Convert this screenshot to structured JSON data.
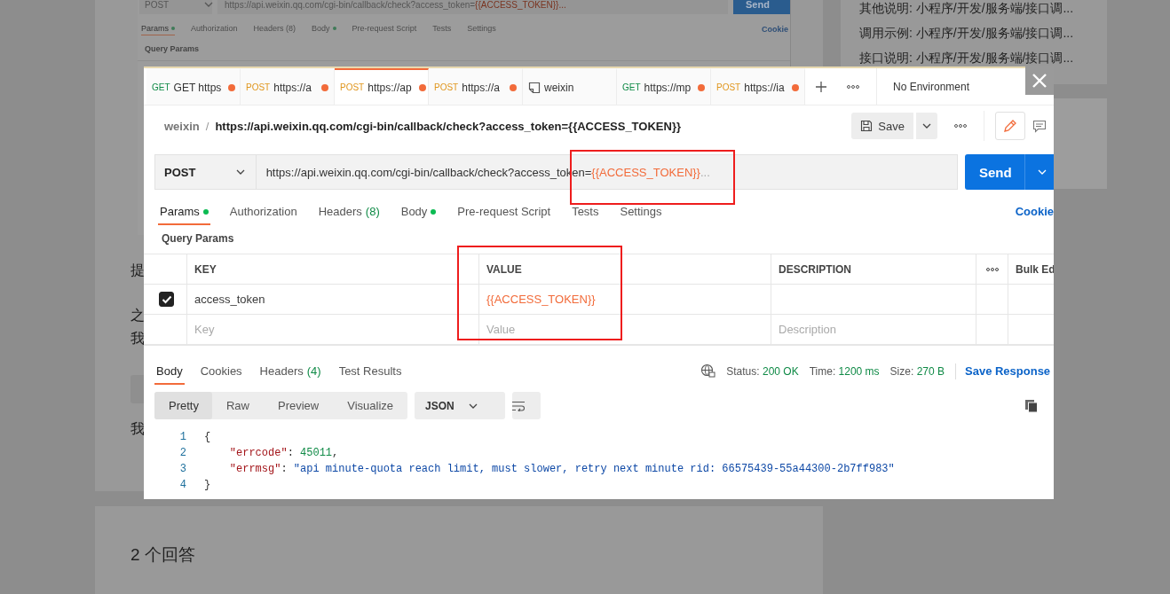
{
  "page": {
    "embedded_screenshot": {
      "method": "POST",
      "url": "https://api.weixin.qq.com/cgi-bin/callback/check?access_token=",
      "url_variable": "{{ACCESS_TOKEN}}",
      "url_more": " ...",
      "send": "Send",
      "tabs": [
        {
          "label": "Params",
          "dot": true,
          "selected": true
        },
        {
          "label": "Authorization",
          "dot": false,
          "selected": false
        },
        {
          "label": "Headers (8)",
          "dot": false,
          "selected": false
        },
        {
          "label": "Body",
          "dot": true,
          "selected": false
        },
        {
          "label": "Pre-request Script",
          "dot": false,
          "selected": false
        },
        {
          "label": "Tests",
          "dot": false,
          "selected": false
        },
        {
          "label": "Settings",
          "dot": false,
          "selected": false
        }
      ],
      "cookies": "Cookie",
      "section": "Query Params"
    },
    "question_text": [
      "提",
      "之",
      "我",
      "我"
    ],
    "answers_heading": "2 个回答",
    "sidebar_links": [
      "其他说明: 小程序/开发/服务端/接口调...",
      "调用示例: 小程序/开发/服务端/接口调...",
      "接口说明: 小程序/开发/服务端/接口调..."
    ]
  },
  "lightbox": {
    "tabs": [
      {
        "kind": "request",
        "method": "GET",
        "label": "GET https",
        "unsaved": true,
        "selected": false
      },
      {
        "kind": "request",
        "method": "POST",
        "label": "https://a",
        "unsaved": true,
        "selected": false
      },
      {
        "kind": "request",
        "method": "POST",
        "label": "https://ap",
        "unsaved": true,
        "selected": true
      },
      {
        "kind": "request",
        "method": "POST",
        "label": "https://a",
        "unsaved": true,
        "selected": false
      },
      {
        "kind": "collection",
        "label": "weixin",
        "unsaved": false,
        "selected": false
      },
      {
        "kind": "request",
        "method": "GET",
        "label": "https://mp",
        "unsaved": true,
        "selected": false
      },
      {
        "kind": "request",
        "method": "POST",
        "label": "https://ia",
        "unsaved": true,
        "selected": false
      }
    ],
    "environment": "No Environment",
    "breadcrumb": {
      "collection": "weixin",
      "separator": "/",
      "request": "https://api.weixin.qq.com/cgi-bin/callback/check?access_token={{ACCESS_TOKEN}}"
    },
    "save": "Save",
    "method": "POST",
    "url": "https://api.weixin.qq.com/cgi-bin/callback/check?access_token=",
    "url_variable": "{{ACCESS_TOKEN}}",
    "url_more": " ...",
    "send": "Send",
    "request_tabs": [
      {
        "label": "Params",
        "dot": true,
        "selected": true
      },
      {
        "label": "Authorization",
        "dot": false,
        "selected": false
      },
      {
        "label": "Headers",
        "count": "(8)",
        "dot": false,
        "selected": false
      },
      {
        "label": "Body",
        "dot": true,
        "selected": false
      },
      {
        "label": "Pre-request Script",
        "dot": false,
        "selected": false
      },
      {
        "label": "Tests",
        "dot": false,
        "selected": false
      },
      {
        "label": "Settings",
        "dot": false,
        "selected": false
      }
    ],
    "cookies": "Cookie",
    "section": "Query Params",
    "columns": [
      "KEY",
      "VALUE",
      "DESCRIPTION"
    ],
    "bulk_edit": "Bulk Ed",
    "params": [
      {
        "checked": true,
        "key": "access_token",
        "value": "{{ACCESS_TOKEN}}"
      }
    ],
    "new_param_fields": [
      {
        "placeholder": "Key"
      },
      {
        "placeholder": "Value"
      },
      {
        "placeholder": "Description"
      }
    ],
    "response_tabs": [
      {
        "label": "Body",
        "selected": true
      },
      {
        "label": "Cookies",
        "selected": false
      },
      {
        "label": "Headers",
        "count": "(4)",
        "selected": false
      },
      {
        "label": "Test Results",
        "selected": false
      }
    ],
    "status": {
      "status_label": "Status:",
      "status": "200 OK",
      "time_label": "Time:",
      "time": "1200 ms",
      "size_label": "Size:",
      "size": "270 B"
    },
    "save_response": "Save Response",
    "views": [
      {
        "label": "Pretty",
        "selected": true
      },
      {
        "label": "Raw",
        "selected": false
      },
      {
        "label": "Preview",
        "selected": false
      },
      {
        "label": "Visualize",
        "selected": false
      }
    ],
    "format": "JSON",
    "code": [
      {
        "num": "1",
        "parts": [
          {
            "kind": "punct",
            "text": "{"
          }
        ]
      },
      {
        "num": "2",
        "parts": [
          {
            "kind": "key",
            "text": "    \"errcode\""
          },
          {
            "kind": "punct",
            "text": ": "
          },
          {
            "kind": "number",
            "text": "45011"
          },
          {
            "kind": "punct",
            "text": ","
          }
        ]
      },
      {
        "num": "3",
        "parts": [
          {
            "kind": "key",
            "text": "    \"errmsg\""
          },
          {
            "kind": "punct",
            "text": ": "
          },
          {
            "kind": "string",
            "text": "\"api minute-quota reach limit, must slower, retry next minute rid: 66575439-55a44300-2b7ff983\""
          }
        ]
      },
      {
        "num": "4",
        "parts": [
          {
            "kind": "punct",
            "text": "}"
          }
        ]
      }
    ],
    "annotations": [
      {
        "kind": "red_box"
      },
      {
        "kind": "red_box"
      }
    ]
  }
}
